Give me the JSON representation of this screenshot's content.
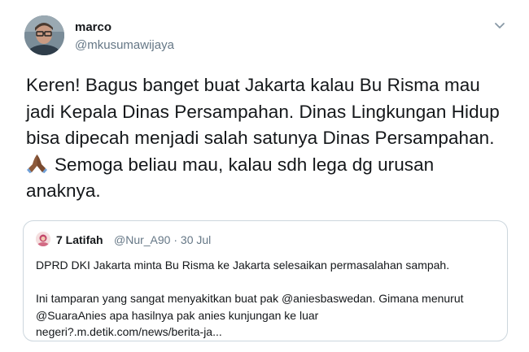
{
  "tweet": {
    "author": {
      "display_name": "marco",
      "handle": "@mkusumawijaya"
    },
    "text_lines": [
      "Keren! Bagus banget buat Jakarta kalau Bu Risma mau",
      "jadi Kepala Dinas Persampahan. Dinas Lingkungan Hidup",
      "bisa dipecah menjadi salah satunya Dinas Persampahan.",
      "Semoga beliau mau, kalau sdh lega dg urusan",
      "anaknya."
    ],
    "emoji_icon": "folded-hands-icon",
    "menu_icon": "chevron-down-icon"
  },
  "quoted_tweet": {
    "display_name": "7 Latifah",
    "meta": "@Nur_A90 · 30 Jul",
    "text_lines": [
      "DPRD DKI Jakarta minta Bu Risma ke Jakarta selesaikan permasalahan sampah.",
      "",
      "Ini tamparan yang sangat menyakitkan buat pak @aniesbaswedan. Gimana menurut",
      "@SuaraAnies apa hasilnya pak anies kunjungan ke luar",
      "negeri?.m.detik.com/news/berita-ja..."
    ]
  },
  "colors": {
    "text_primary": "#14171a",
    "text_secondary": "#657786",
    "border": "#ccd6dd"
  }
}
